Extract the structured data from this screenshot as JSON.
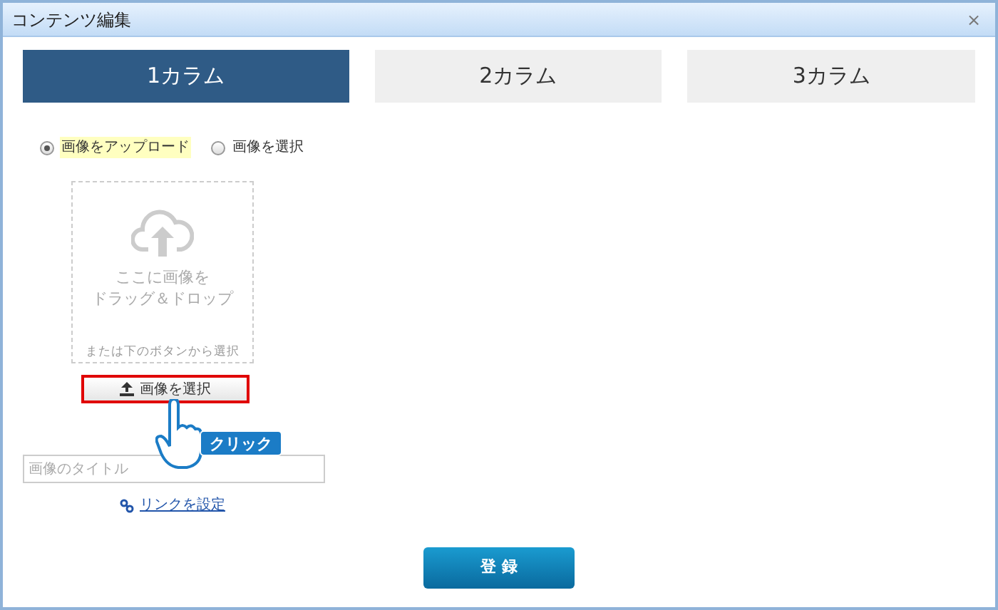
{
  "window": {
    "title": "コンテンツ編集",
    "close": "×"
  },
  "tabs": [
    {
      "label": "1カラム",
      "selected": true
    },
    {
      "label": "2カラム",
      "selected": false
    },
    {
      "label": "3カラム",
      "selected": false
    }
  ],
  "source_options": [
    {
      "label": "画像をアップロード",
      "selected": true
    },
    {
      "label": "画像を選択",
      "selected": false
    }
  ],
  "drop_zone": {
    "message_lines": [
      "ここに画像を",
      "ドラッグ＆ドロップ"
    ],
    "hint": "または下のボタンから選択"
  },
  "select_button": {
    "label": "画像を選択",
    "highlighted": true
  },
  "annotation": {
    "label": "クリック"
  },
  "title_field": {
    "placeholder": "画像のタイトル"
  },
  "link": {
    "label": "リンクを設定"
  },
  "submit_button": {
    "label": "登 録"
  }
}
